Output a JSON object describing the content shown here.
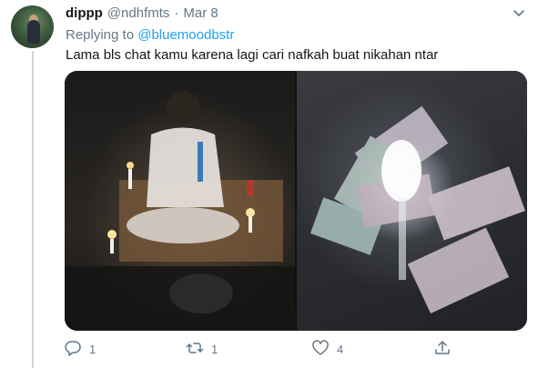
{
  "tweet": {
    "display_name": "dippp",
    "handle": "@ndhfmts",
    "separator": "·",
    "date": "Mar 8",
    "replying_prefix": "Replying to",
    "replying_to": "@bluemoodbstr",
    "text": "Lama bls chat kamu karena lagi cari nafkah buat nikahan ntar"
  },
  "actions": {
    "reply_count": "1",
    "retweet_count": "1",
    "like_count": "4"
  },
  "icons": {
    "caret": "chevron-down-icon",
    "reply": "reply-icon",
    "retweet": "retweet-icon",
    "like": "heart-icon",
    "share": "share-icon"
  },
  "colors": {
    "accent": "#1da1f2",
    "secondary_text": "#657786",
    "thread_line": "#ccd6dd"
  }
}
